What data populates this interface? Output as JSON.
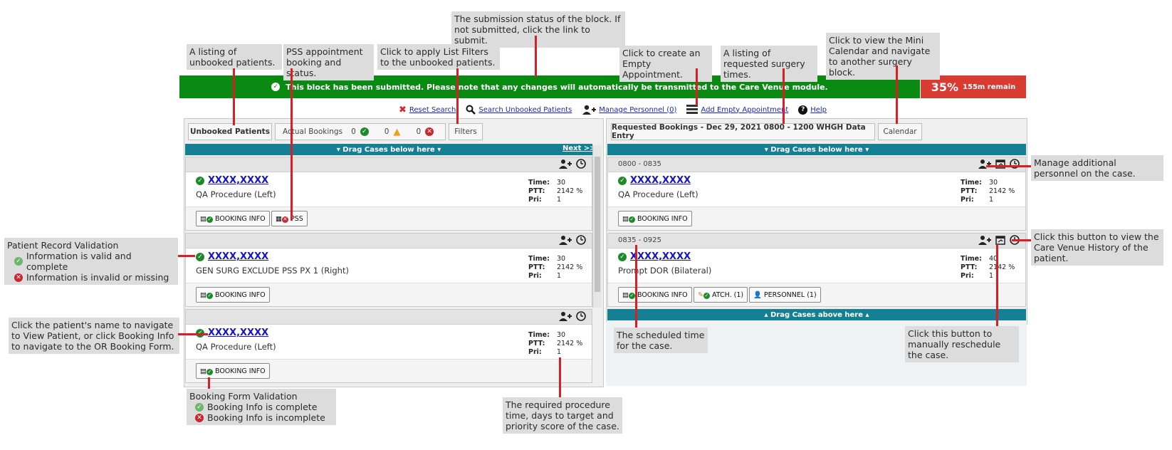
{
  "banner": {
    "text": "This block has been submitted. Please note that any changes will automatically be transmitted to the Care Venue module."
  },
  "progress": {
    "percent": "35%",
    "remain": "155m remain",
    "value": 35
  },
  "toolbar": {
    "reset": "Reset Search",
    "search": "Search Unbooked Patients",
    "manage": "Manage Personnel (0)",
    "add": "Add Empty Appointment",
    "help": "Help"
  },
  "left_panel": {
    "tab_unbooked": "Unbooked Patients",
    "tab_actual": "Actual Bookings",
    "count_ok": "0",
    "count_warn": "0",
    "count_bad": "0",
    "filters": "Filters",
    "drag_below": "▾ Drag Cases below here ▾",
    "next": "Next >>",
    "cards": [
      {
        "name": "XXXX,XXXX",
        "procedure": "QA Procedure (Left)",
        "time": "30",
        "ptt": "2142 %",
        "pri": "1"
      },
      {
        "name": "XXXX,XXXX",
        "procedure": "GEN SURG EXCLUDE PSS PX 1 (Right)",
        "time": "30",
        "ptt": "2142 %",
        "pri": "1"
      },
      {
        "name": "XXXX,XXXX",
        "procedure": "QA Procedure (Left)",
        "time": "30",
        "ptt": "2142 %",
        "pri": "1"
      }
    ]
  },
  "right_panel": {
    "title": "Requested Bookings - Dec 29, 2021   0800 - 1200   WHGH Data Entry",
    "calendar": "Calendar",
    "drag_below": "▾ Drag Cases below here ▾",
    "drag_above": "▴ Drag Cases above here ▴",
    "cards": [
      {
        "slot": "0800 - 0835",
        "name": "XXXX,XXXX",
        "procedure": "QA Procedure (Left)",
        "time": "30",
        "ptt": "2142 %",
        "pri": "1"
      },
      {
        "slot": "0835 - 0925",
        "name": "XXXX,XXXX",
        "procedure": "Prompt DOR (Bilateral)",
        "time": "40",
        "ptt": "2142 %",
        "pri": "1"
      }
    ]
  },
  "labels": {
    "time": "Time:",
    "ptt": "PTT:",
    "pri": "Pri:",
    "booking_info": "BOOKING INFO",
    "pss": "PSS",
    "attach": "ATCH. (1)",
    "personnel": "PERSONNEL (1)"
  },
  "callouts": {
    "submission": "The submission status of the block. If not submitted, click the link to submit.",
    "unbooked_list": "A listing of unbooked patients.",
    "pss": "PSS appointment booking and status.",
    "filters": "Click to apply List Filters to the unbooked patients.",
    "empty_appt": "Click to create an Empty Appointment.",
    "requested_times": "A listing of requested surgery times.",
    "mini_calendar": "Click to view the Mini Calendar and navigate to another surgery block.",
    "manage_personnel": "Manage additional personnel on the case.",
    "care_venue": "Click this button to view the Care Venue History of the patient.",
    "reschedule": "Click this button to manually reschedule the case.",
    "scheduled_time": "The scheduled time for the case.",
    "required_time": "The required procedure time, days to target and priority score of the case.",
    "patient_name": "Click the patient's name to navigate to View Patient, or click Booking Info to navigate to the OR Booking Form.",
    "prv_title": "Patient Record Validation",
    "prv_ok": "Information is valid and complete",
    "prv_bad": "Information is invalid or missing",
    "bfv_title": "Booking Form Validation",
    "bfv_ok": "Booking Info is complete",
    "bfv_bad": "Booking Info is incomplete"
  }
}
